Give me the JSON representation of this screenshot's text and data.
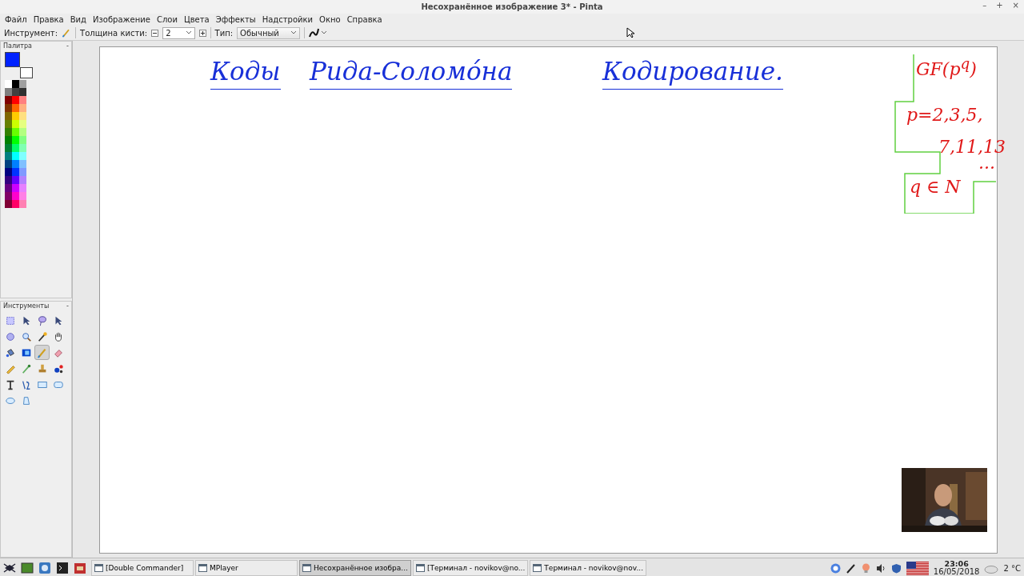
{
  "window": {
    "title": "Несохранённое изображение 3* - Pinta",
    "controls": [
      "–",
      "+",
      "×"
    ]
  },
  "menu": [
    "Файл",
    "Правка",
    "Вид",
    "Изображение",
    "Слои",
    "Цвета",
    "Эффекты",
    "Надстройки",
    "Окно",
    "Справка"
  ],
  "toolbar": {
    "tool_label": "Инструмент:",
    "brush_label": "Толщина кисти:",
    "brush_value": "2",
    "type_label": "Тип:",
    "type_value": "Обычный"
  },
  "palette": {
    "title": "Палитра",
    "collapse": "-",
    "primary": {
      "color": "#0022ff"
    },
    "secondary": {
      "color": "#ffffff"
    },
    "swatches": [
      {
        "color": "#ffffff"
      },
      {
        "color": "#000000"
      },
      {
        "color": "#a0a0a0"
      },
      {
        "color": "#808080"
      },
      {
        "color": "#404040"
      },
      {
        "color": "#303030"
      },
      {
        "color": "#800000"
      },
      {
        "color": "#ff0000"
      },
      {
        "color": "#ff8080"
      },
      {
        "color": "#803300"
      },
      {
        "color": "#ff6600"
      },
      {
        "color": "#ffb080"
      },
      {
        "color": "#806600"
      },
      {
        "color": "#ffcc00"
      },
      {
        "color": "#ffe080"
      },
      {
        "color": "#668000"
      },
      {
        "color": "#ccff00"
      },
      {
        "color": "#e6ff80"
      },
      {
        "color": "#338000"
      },
      {
        "color": "#66ff00"
      },
      {
        "color": "#b3ff80"
      },
      {
        "color": "#008000"
      },
      {
        "color": "#00ff00"
      },
      {
        "color": "#80ff80"
      },
      {
        "color": "#008033"
      },
      {
        "color": "#00ff66"
      },
      {
        "color": "#80ffb3"
      },
      {
        "color": "#008080"
      },
      {
        "color": "#00ffff"
      },
      {
        "color": "#80ffff"
      },
      {
        "color": "#004080"
      },
      {
        "color": "#0080ff"
      },
      {
        "color": "#80c0ff"
      },
      {
        "color": "#000080"
      },
      {
        "color": "#0033ff"
      },
      {
        "color": "#8099ff"
      },
      {
        "color": "#330080"
      },
      {
        "color": "#6600ff"
      },
      {
        "color": "#b380ff"
      },
      {
        "color": "#660080"
      },
      {
        "color": "#cc00ff"
      },
      {
        "color": "#e680ff"
      },
      {
        "color": "#800066"
      },
      {
        "color": "#ff00cc"
      },
      {
        "color": "#ff80e6"
      },
      {
        "color": "#800033"
      },
      {
        "color": "#ff0066"
      },
      {
        "color": "#ff80b3"
      }
    ]
  },
  "tools": {
    "title": "Инструменты",
    "collapse": "-",
    "items": [
      {
        "kind": "select",
        "selected": false
      },
      {
        "kind": "move",
        "selected": false
      },
      {
        "kind": "lasso",
        "selected": false
      },
      {
        "kind": "move",
        "selected": false
      },
      {
        "kind": "ellipse-select",
        "selected": false
      },
      {
        "kind": "zoom",
        "selected": false
      },
      {
        "kind": "wand",
        "selected": false
      },
      {
        "kind": "pan",
        "selected": false
      },
      {
        "kind": "bucket",
        "selected": false
      },
      {
        "kind": "gradient",
        "selected": false
      },
      {
        "kind": "brush",
        "selected": true
      },
      {
        "kind": "eraser",
        "selected": false
      },
      {
        "kind": "pencil",
        "selected": false
      },
      {
        "kind": "dropper",
        "selected": false
      },
      {
        "kind": "stamp",
        "selected": false
      },
      {
        "kind": "recolor",
        "selected": false
      },
      {
        "kind": "text",
        "selected": false
      },
      {
        "kind": "line",
        "selected": false
      },
      {
        "kind": "rectangle",
        "selected": false
      },
      {
        "kind": "rounded",
        "selected": false
      },
      {
        "kind": "ellipse",
        "selected": false
      },
      {
        "kind": "freeform",
        "selected": false
      }
    ]
  },
  "canvas": {
    "heading": [
      "Коды",
      "Рида-Соломóна",
      "Кодирование."
    ],
    "notes": [
      "GF(p$^{q}$)",
      "p=2,3,5,",
      "7,11,13",
      "...",
      "q ∈ N"
    ]
  },
  "taskbar": {
    "tasks": [
      {
        "label": "[Double Commander]",
        "selected": false
      },
      {
        "label": "MPlayer",
        "selected": false
      },
      {
        "label": "Несохранённое изобра...",
        "selected": true
      },
      {
        "label": "[Терминал - novikov@no...",
        "selected": false
      },
      {
        "label": "Терминал - novikov@nov...",
        "selected": false
      }
    ],
    "time": "23:06",
    "date": "16/05/2018",
    "weather": "2 °C"
  }
}
